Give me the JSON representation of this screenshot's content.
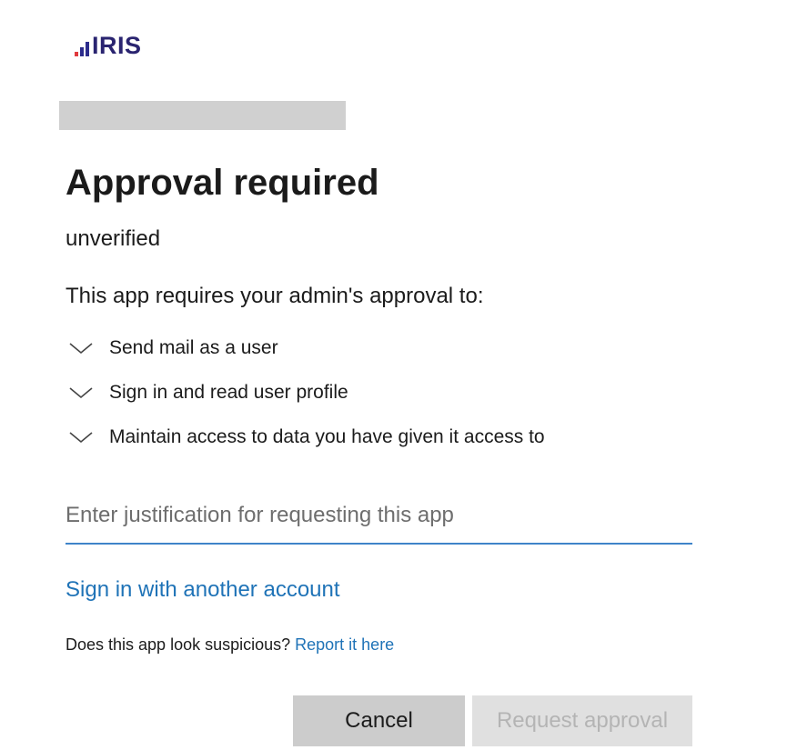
{
  "brand": {
    "name": "IRIS",
    "bar_colors": [
      "#e03a3e",
      "#2b2b8c",
      "#2b2b8c"
    ],
    "text_color": "#2a2470"
  },
  "dialog": {
    "title": "Approval required",
    "publisher": "unverified",
    "intro": "This app requires your admin's approval to:",
    "permissions": [
      {
        "label": "Send mail as a user",
        "icon": "chevron-down-icon"
      },
      {
        "label": "Sign in and read user profile",
        "icon": "chevron-down-icon"
      },
      {
        "label": "Maintain access to data you have given it access to",
        "icon": "chevron-down-icon"
      }
    ],
    "justification": {
      "value": "",
      "placeholder": "Enter justification for requesting this app"
    },
    "other_account_link": "Sign in with another account",
    "suspicious": {
      "question": "Does this app look suspicious?",
      "link": "Report it here"
    },
    "buttons": {
      "cancel": "Cancel",
      "request": "Request approval"
    }
  },
  "colors": {
    "link": "#1f73b7",
    "input_underline": "#3f84c9",
    "cancel_bg": "#cccccc",
    "request_bg_disabled": "#e0e0e0",
    "request_text_disabled": "#b4b4b4"
  }
}
